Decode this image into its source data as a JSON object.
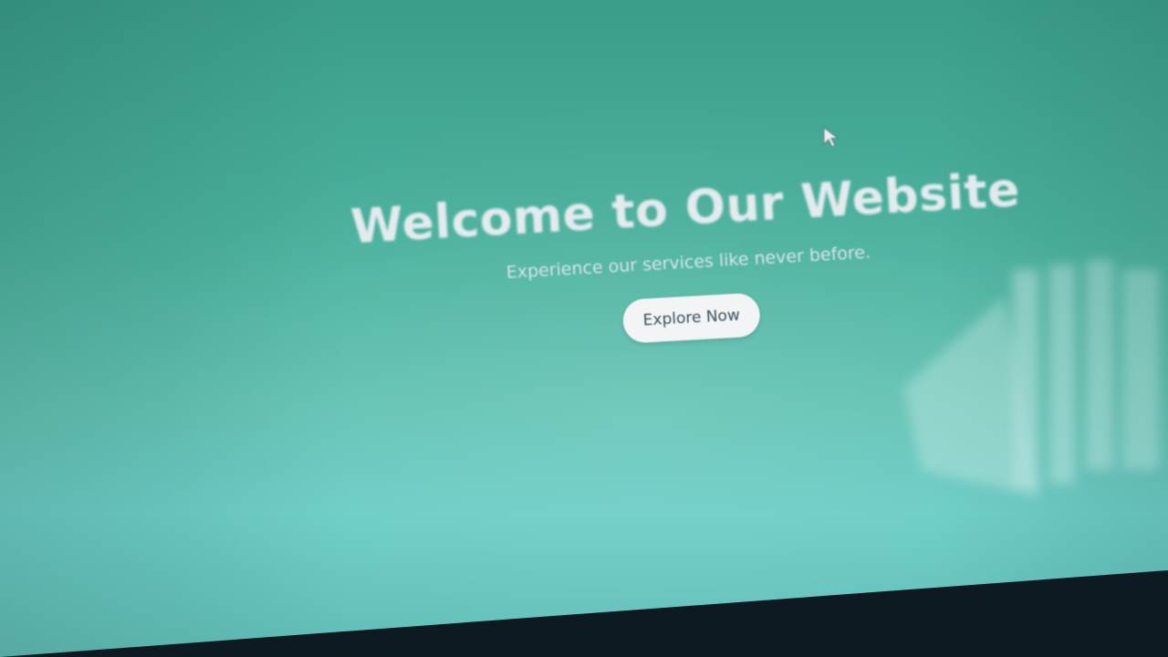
{
  "hero": {
    "title": "Welcome to Our Website",
    "subtitle": "Experience our services like never before.",
    "cta_label": "Explore Now"
  },
  "colors": {
    "background_top": "#3a9d8a",
    "background_bottom": "#6ccdc7",
    "title_text": "#f0f0f6",
    "button_bg": "#f3f4f6",
    "button_text": "#3a5058"
  },
  "icons": {
    "cursor": "mouse-pointer-icon"
  }
}
